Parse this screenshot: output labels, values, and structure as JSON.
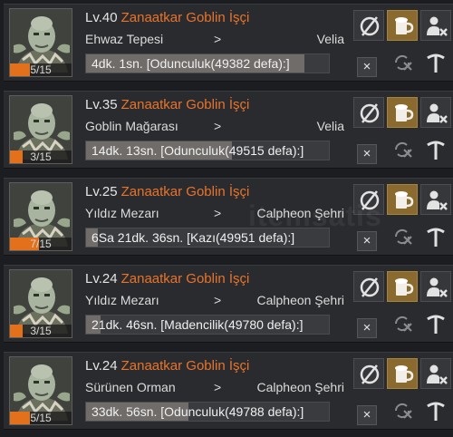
{
  "workers": [
    {
      "level": "Lv.40",
      "name": "Zanaatkar Goblin İşçi",
      "stamina": "5/15",
      "stamina_fraction": 0.33,
      "from": "Ehwaz Tepesi",
      "arrow": ">",
      "to": "Velia",
      "task": "4dk. 1sn. [Odunculuk(49382 defa):]",
      "task_progress": 0.9,
      "close": "×"
    },
    {
      "level": "Lv.35",
      "name": "Zanaatkar Goblin İşçi",
      "stamina": "3/15",
      "stamina_fraction": 0.2,
      "from": "Goblin Mağarası",
      "arrow": ">",
      "to": "Velia",
      "task": "14dk. 13sn. [Odunculuk(49515 defa):]",
      "task_progress": 0.6,
      "close": "×"
    },
    {
      "level": "Lv.25",
      "name": "Zanaatkar Goblin İşçi",
      "stamina": "7/15",
      "stamina_fraction": 0.47,
      "from": "Yıldız Mezarı",
      "arrow": ">",
      "to": "Calpheon Şehri",
      "task": "6Sa 21dk. 36sn. [Kazı(49951 defa):]",
      "task_progress": 0.05,
      "close": "×"
    },
    {
      "level": "Lv.24",
      "name": "Zanaatkar Goblin İşçi",
      "stamina": "3/15",
      "stamina_fraction": 0.2,
      "from": "Yıldız Mezarı",
      "arrow": ">",
      "to": "Calpheon Şehri",
      "task": "21dk. 46sn. [Madencilik(49780 defa):]",
      "task_progress": 0.06,
      "close": "×"
    },
    {
      "level": "Lv.24",
      "name": "Zanaatkar Goblin İşçi",
      "stamina": "5/15",
      "stamina_fraction": 0.33,
      "from": "Sürünen Orman",
      "arrow": ">",
      "to": "Calpheon Şehri",
      "task": "33dk. 56sn. [Odunculuk(49788 defa):]",
      "task_progress": 0.42,
      "close": "×"
    }
  ],
  "watermark": "itemsatis",
  "icons": [
    "no-entry-icon",
    "beer-mug-icon",
    "fire-worker-icon",
    "repeat-cancel-icon",
    "pickaxe-icon"
  ],
  "colors": {
    "accent": "#e8742b",
    "stamina": "#e3701b",
    "active_button": "#8a6a2f"
  }
}
